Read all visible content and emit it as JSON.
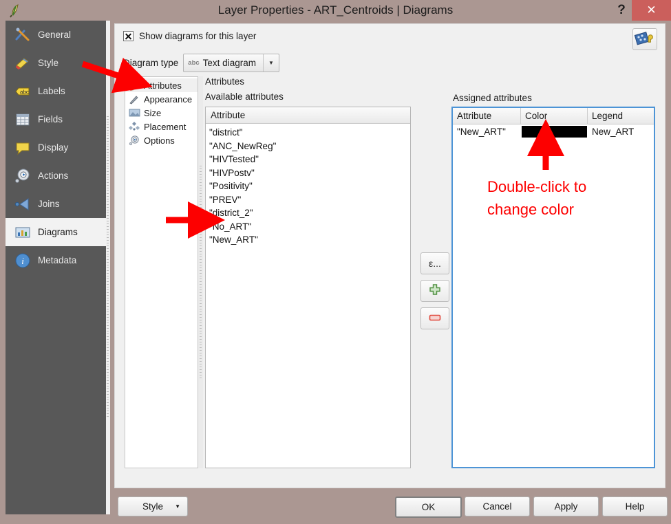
{
  "window": {
    "title": "Layer Properties - ART_Centroids | Diagrams",
    "logo_icon": "qgis-logo-icon",
    "help_button": "?",
    "close_button": "✕"
  },
  "sidebar": {
    "items": [
      {
        "label": "General",
        "icon": "general-icon",
        "selected": false
      },
      {
        "label": "Style",
        "icon": "style-icon",
        "selected": false
      },
      {
        "label": "Labels",
        "icon": "labels-icon",
        "selected": false
      },
      {
        "label": "Fields",
        "icon": "fields-icon",
        "selected": false
      },
      {
        "label": "Display",
        "icon": "display-icon",
        "selected": false
      },
      {
        "label": "Actions",
        "icon": "actions-icon",
        "selected": false
      },
      {
        "label": "Joins",
        "icon": "joins-icon",
        "selected": false
      },
      {
        "label": "Diagrams",
        "icon": "diagrams-icon",
        "selected": true
      },
      {
        "label": "Metadata",
        "icon": "metadata-icon",
        "selected": false
      }
    ]
  },
  "main": {
    "show_diagrams_checkbox": {
      "label": "Show diagrams for this layer",
      "checked": true
    },
    "data_defined_override_icon": "data-defined-override-icon",
    "diagram_type": {
      "label": "Diagram type",
      "value": "Text diagram",
      "icon_text": "abc",
      "arrow": "▼"
    },
    "subtabs": [
      {
        "label": "Attributes",
        "icon": "attributes-icon",
        "selected": true
      },
      {
        "label": "Appearance",
        "icon": "appearance-icon",
        "selected": false
      },
      {
        "label": "Size",
        "icon": "size-icon",
        "selected": false
      },
      {
        "label": "Placement",
        "icon": "placement-icon",
        "selected": false
      },
      {
        "label": "Options",
        "icon": "options-icon",
        "selected": false
      }
    ],
    "attributes_section": {
      "title": "Attributes",
      "available_label": "Available attributes",
      "column_header": "Attribute",
      "items": [
        "\"district\"",
        "\"ANC_NewReg\"",
        "\"HIVTested\"",
        "\"HIVPostv\"",
        "\"Positivity\"",
        "\"PREV\"",
        "\"district_2\"",
        "\"No_ART\"",
        "\"New_ART\""
      ]
    },
    "transfer_buttons": [
      {
        "label": "ε...",
        "name": "expression-button"
      },
      {
        "label": "",
        "name": "add-attribute-button"
      },
      {
        "label": "",
        "name": "remove-attribute-button"
      }
    ],
    "assigned_section": {
      "label": "Assigned attributes",
      "columns": [
        "Attribute",
        "Color",
        "Legend"
      ],
      "rows": [
        {
          "attribute": "\"New_ART\"",
          "color": "#000000",
          "legend": "New_ART"
        }
      ]
    }
  },
  "footer": {
    "style_button": "Style",
    "style_arrow": "▼",
    "ok_button": "OK",
    "cancel_button": "Cancel",
    "apply_button": "Apply",
    "help_button": "Help"
  },
  "annotations": {
    "callout_line1": "Double-click to",
    "callout_line2": "change color",
    "callout_color": "#fd0000"
  }
}
